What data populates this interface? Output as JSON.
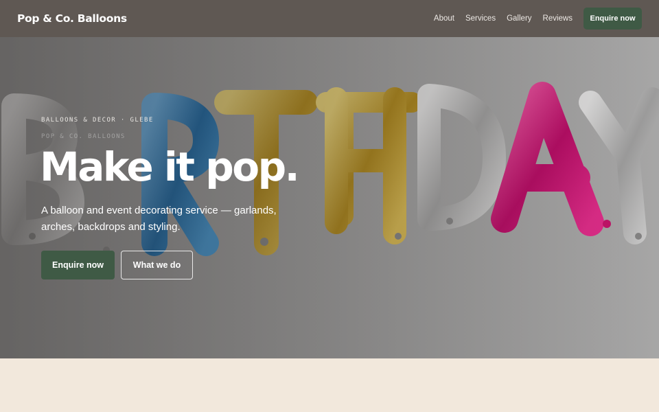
{
  "header": {
    "brand": "Pop & Co. Balloons",
    "nav": [
      {
        "label": "About"
      },
      {
        "label": "Services"
      },
      {
        "label": "Gallery"
      },
      {
        "label": "Reviews"
      }
    ],
    "cta_label": "Enquire now"
  },
  "hero": {
    "eyebrow": "BALLOONS & DECOR · GLEBE",
    "eyebrow_ghost": "POP & CO. BALLOONS",
    "headline": "Make it pop.",
    "lede": "A balloon and event decorating service — garlands, arches, backdrops and styling.",
    "primary_button": "Enquire now",
    "secondary_button": "What we do",
    "background_image": "birthday-letter-balloons-photo"
  },
  "colors": {
    "header_bg": "#5f5853",
    "accent_green": "#3f5a45",
    "page_bg": "#f2e8dc",
    "balloon_silver": "#c9c9c9",
    "balloon_blue": "#2f86c8",
    "balloon_gold": "#d9b43a",
    "balloon_pink": "#e0167f"
  }
}
